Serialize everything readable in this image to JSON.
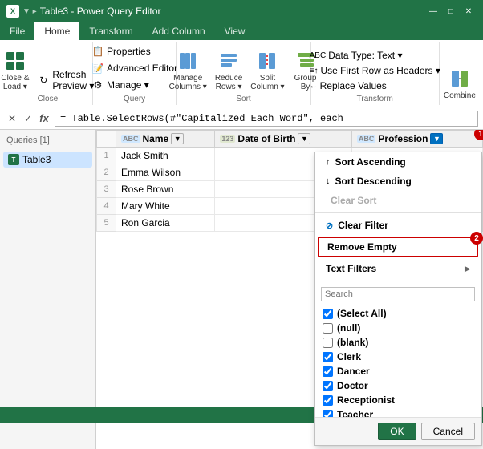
{
  "titleBar": {
    "logo": "X",
    "title": "Table3 - Power Query Editor",
    "controls": [
      "—",
      "□",
      "✕"
    ]
  },
  "ribbon": {
    "tabs": [
      "File",
      "Home",
      "Transform",
      "Add Column",
      "View"
    ],
    "activeTab": "Home",
    "groups": [
      {
        "label": "Close",
        "items": [
          "Close & Load ▾",
          "Refresh Preview ▾"
        ]
      },
      {
        "label": "Query",
        "items": [
          "Properties",
          "Advanced Editor",
          "Manage ▾"
        ]
      },
      {
        "label": "Sort",
        "items": [
          "Manage Columns ▾",
          "Reduce Rows ▾",
          "Split Column ▾",
          "Group By"
        ]
      },
      {
        "label": "Transform",
        "items": [
          "Data Type: Text ▾",
          "Use First Row as Headers ▾",
          "Replace Values"
        ]
      },
      {
        "label": "",
        "items": [
          "Combine"
        ]
      }
    ]
  },
  "formulaBar": {
    "cancelIcon": "✕",
    "confirmIcon": "✓",
    "fxIcon": "fx",
    "formula": "= Table.SelectRows(#\"Capitalized Each Word\", each"
  },
  "queriesPanel": {
    "header": "Queries [1]",
    "items": [
      {
        "name": "Table3",
        "selected": true
      }
    ]
  },
  "table": {
    "columns": [
      {
        "type": "ABC",
        "name": "Name",
        "hasFilter": false
      },
      {
        "type": "123",
        "name": "Date of Birth",
        "hasFilter": false
      },
      {
        "type": "ABC",
        "name": "Profession",
        "hasFilter": true
      }
    ],
    "rows": [
      {
        "num": "1",
        "name": "Jack Smith",
        "dob": "",
        "profession": ""
      },
      {
        "num": "2",
        "name": "Emma Wilson",
        "dob": "",
        "profession": ""
      },
      {
        "num": "3",
        "name": "Rose Brown",
        "dob": "",
        "profession": ""
      },
      {
        "num": "4",
        "name": "Mary White",
        "dob": "",
        "profession": ""
      },
      {
        "num": "5",
        "name": "Ron Garcia",
        "dob": "",
        "profession": ""
      }
    ]
  },
  "dropdown": {
    "items": [
      {
        "type": "sort",
        "label": "Sort Ascending",
        "icon": "↑"
      },
      {
        "type": "sort",
        "label": "Sort Descending",
        "icon": "↓"
      },
      {
        "type": "sort-disabled",
        "label": "Clear Sort",
        "icon": ""
      },
      {
        "type": "divider"
      },
      {
        "type": "filter",
        "label": "Clear Filter",
        "icon": "🔻"
      },
      {
        "type": "remove-empty",
        "label": "Remove Empty"
      },
      {
        "type": "submenu",
        "label": "Text Filters"
      },
      {
        "type": "divider"
      },
      {
        "type": "search",
        "placeholder": "Search"
      }
    ],
    "checkboxItems": [
      {
        "label": "(Select All)",
        "checked": true
      },
      {
        "label": "(null)",
        "checked": false
      },
      {
        "label": "(blank)",
        "checked": false
      },
      {
        "label": "Clerk",
        "checked": true
      },
      {
        "label": "Dancer",
        "checked": true
      },
      {
        "label": "Doctor",
        "checked": true
      },
      {
        "label": "Receptionist",
        "checked": true
      },
      {
        "label": "Teacher",
        "checked": true
      }
    ],
    "footer": {
      "ok": "OK",
      "cancel": "Cancel"
    }
  },
  "badges": {
    "filterBadge": "1",
    "removeEmptyBadge": "2"
  },
  "statusBar": {
    "text": ""
  }
}
